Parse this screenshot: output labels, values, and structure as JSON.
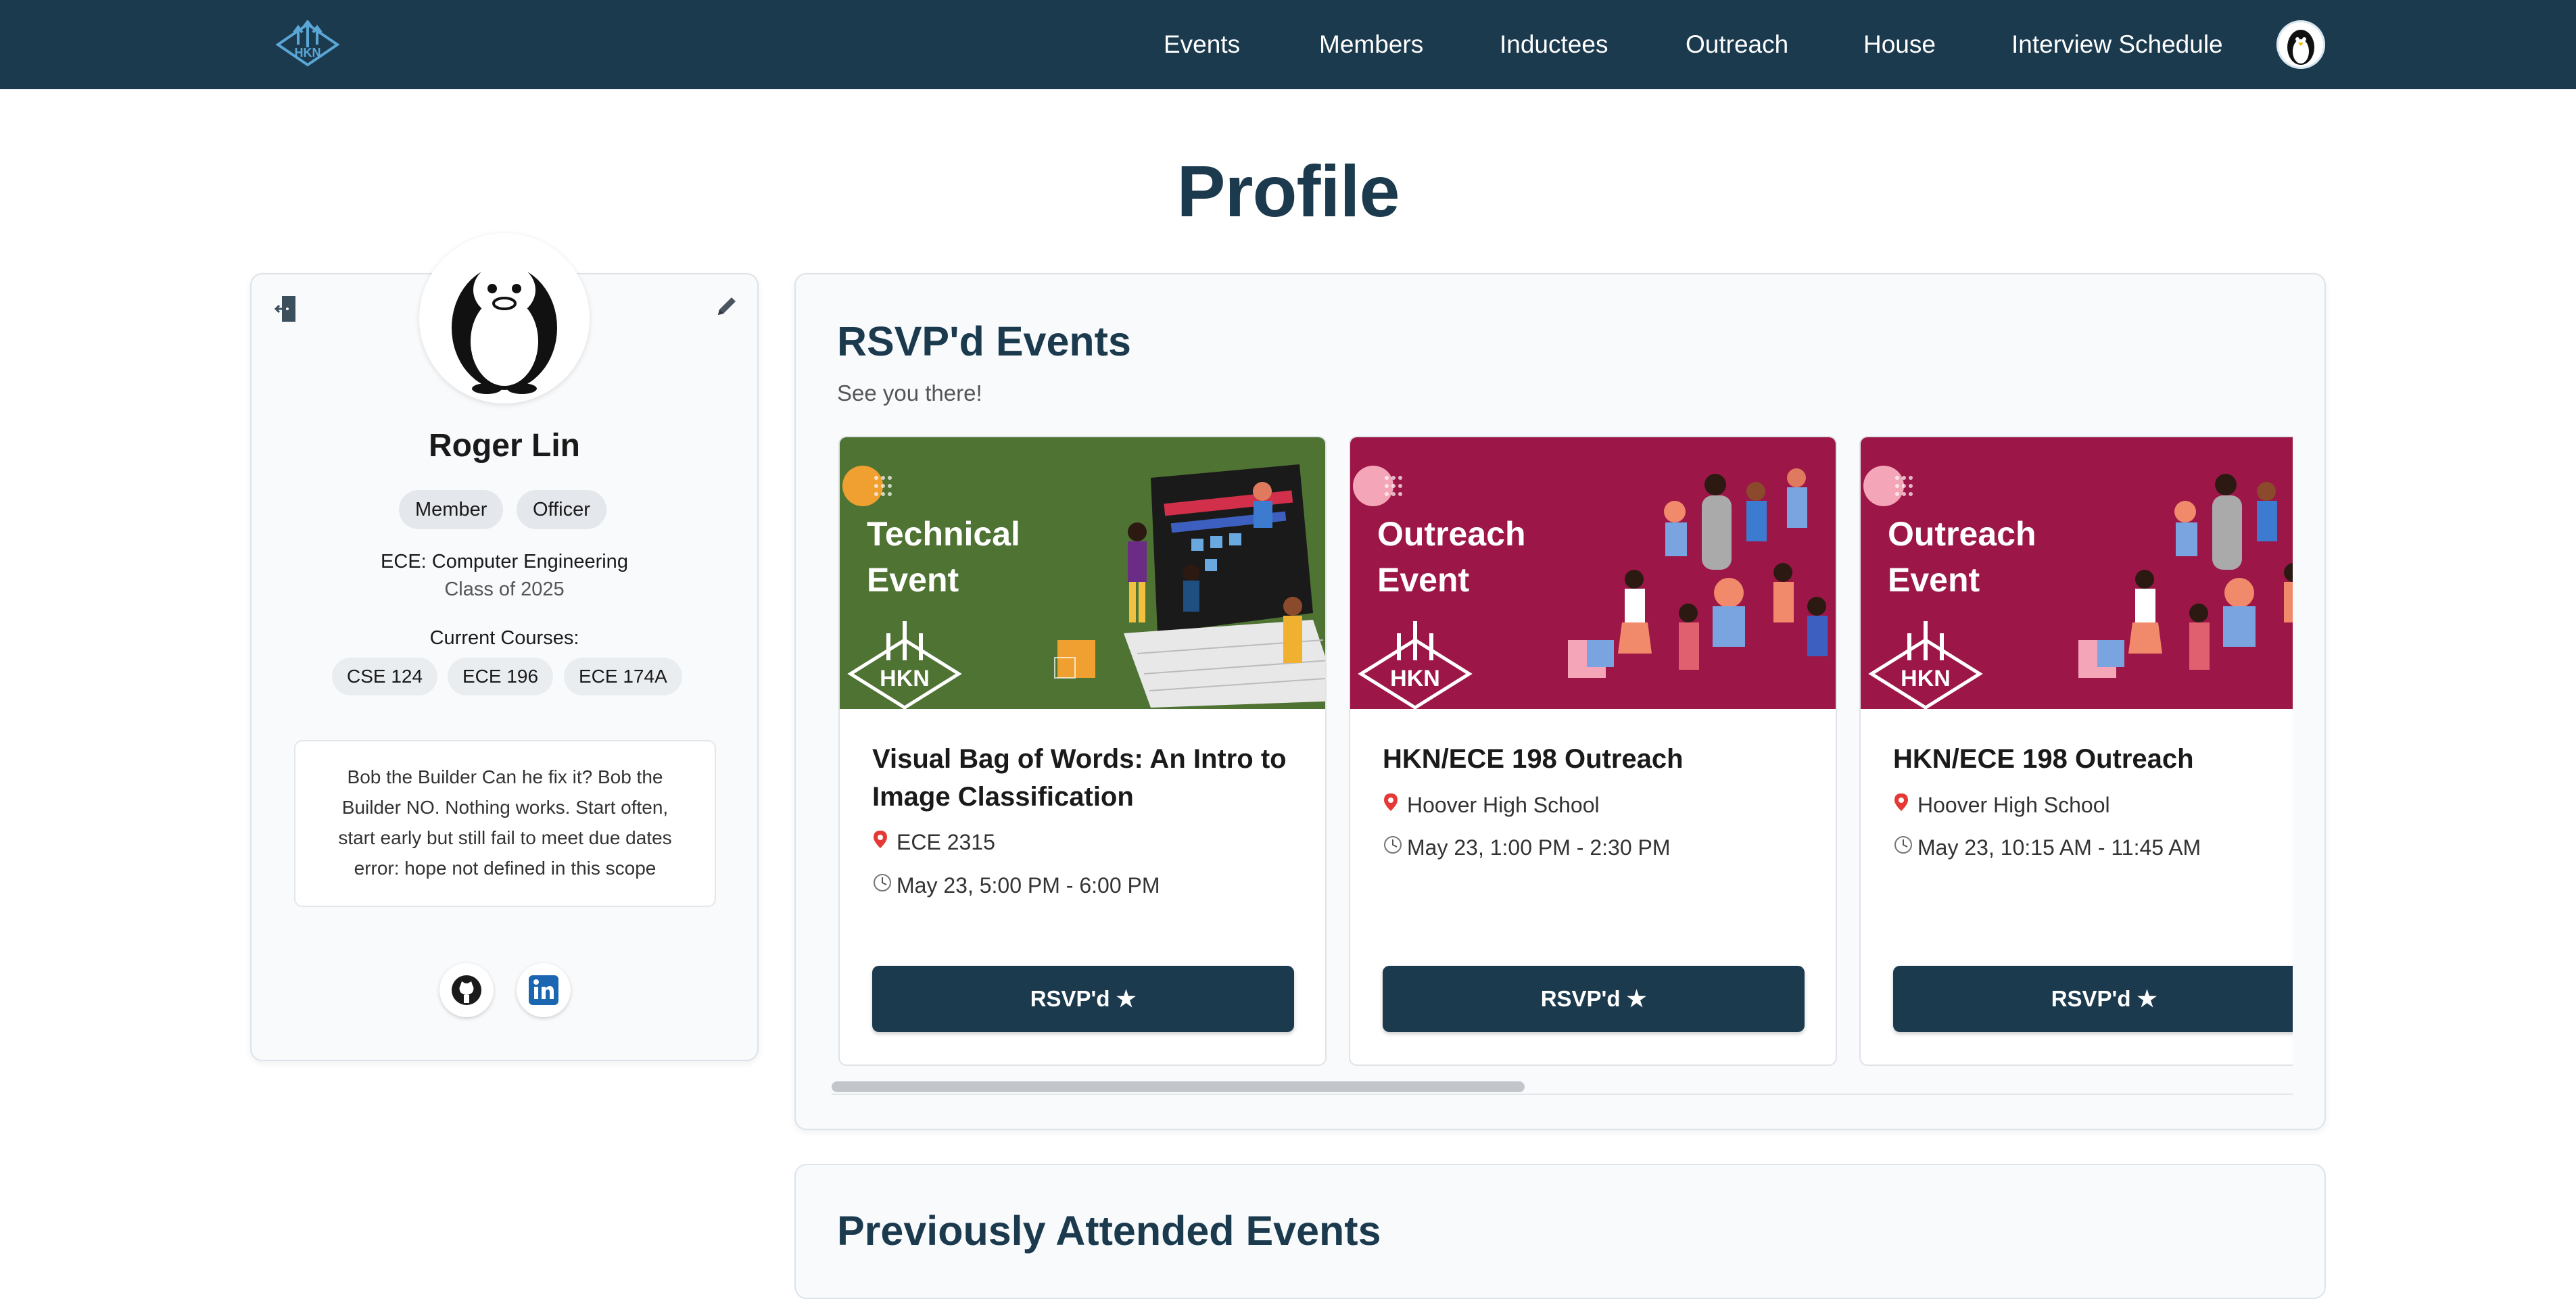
{
  "nav": {
    "logo_text": "HKN",
    "links": [
      "Events",
      "Members",
      "Inductees",
      "Outreach",
      "House",
      "Interview Schedule"
    ]
  },
  "page": {
    "title": "Profile"
  },
  "profile": {
    "name": "Roger Lin",
    "roles": [
      "Member",
      "Officer"
    ],
    "major": "ECE: Computer Engineering",
    "class_year": "Class of 2025",
    "courses_label": "Current Courses:",
    "courses": [
      "CSE 124",
      "ECE 196",
      "ECE 174A"
    ],
    "bio_lines": [
      "Bob the Builder Can he fix it? Bob the",
      "Builder NO. Nothing works. Start often,",
      "start early but still fail to meet due dates",
      "error: hope not defined in this scope"
    ]
  },
  "rsvp": {
    "title": "RSVP'd Events",
    "subtitle": "See you there!",
    "events": [
      {
        "banner_line1": "Technical",
        "banner_line2": "Event",
        "banner_logo": "HKN",
        "banner_color": "#4f7333",
        "title": "Visual Bag of Words: An Intro to Image Classification",
        "location": "ECE 2315",
        "time": "May 23, 5:00 PM - 6:00 PM",
        "button": "RSVP'd ★"
      },
      {
        "banner_line1": "Outreach",
        "banner_line2": "Event",
        "banner_logo": "HKN",
        "banner_color": "#9c1747",
        "title": "HKN/ECE 198 Outreach",
        "location": "Hoover High School",
        "time": "May 23, 1:00 PM - 2:30 PM",
        "button": "RSVP'd ★"
      },
      {
        "banner_line1": "Outreach",
        "banner_line2": "Event",
        "banner_logo": "HKN",
        "banner_color": "#9c1747",
        "title": "HKN/ECE 198 Outreach",
        "location": "Hoover High School",
        "time": "May 23, 10:15 AM - 11:45 AM",
        "button": "RSVP'd ★"
      }
    ]
  },
  "previous": {
    "title": "Previously Attended Events"
  },
  "colors": {
    "navy": "#1c3a4e",
    "technical_green": "#4f7333",
    "outreach_maroon": "#9c1747"
  }
}
